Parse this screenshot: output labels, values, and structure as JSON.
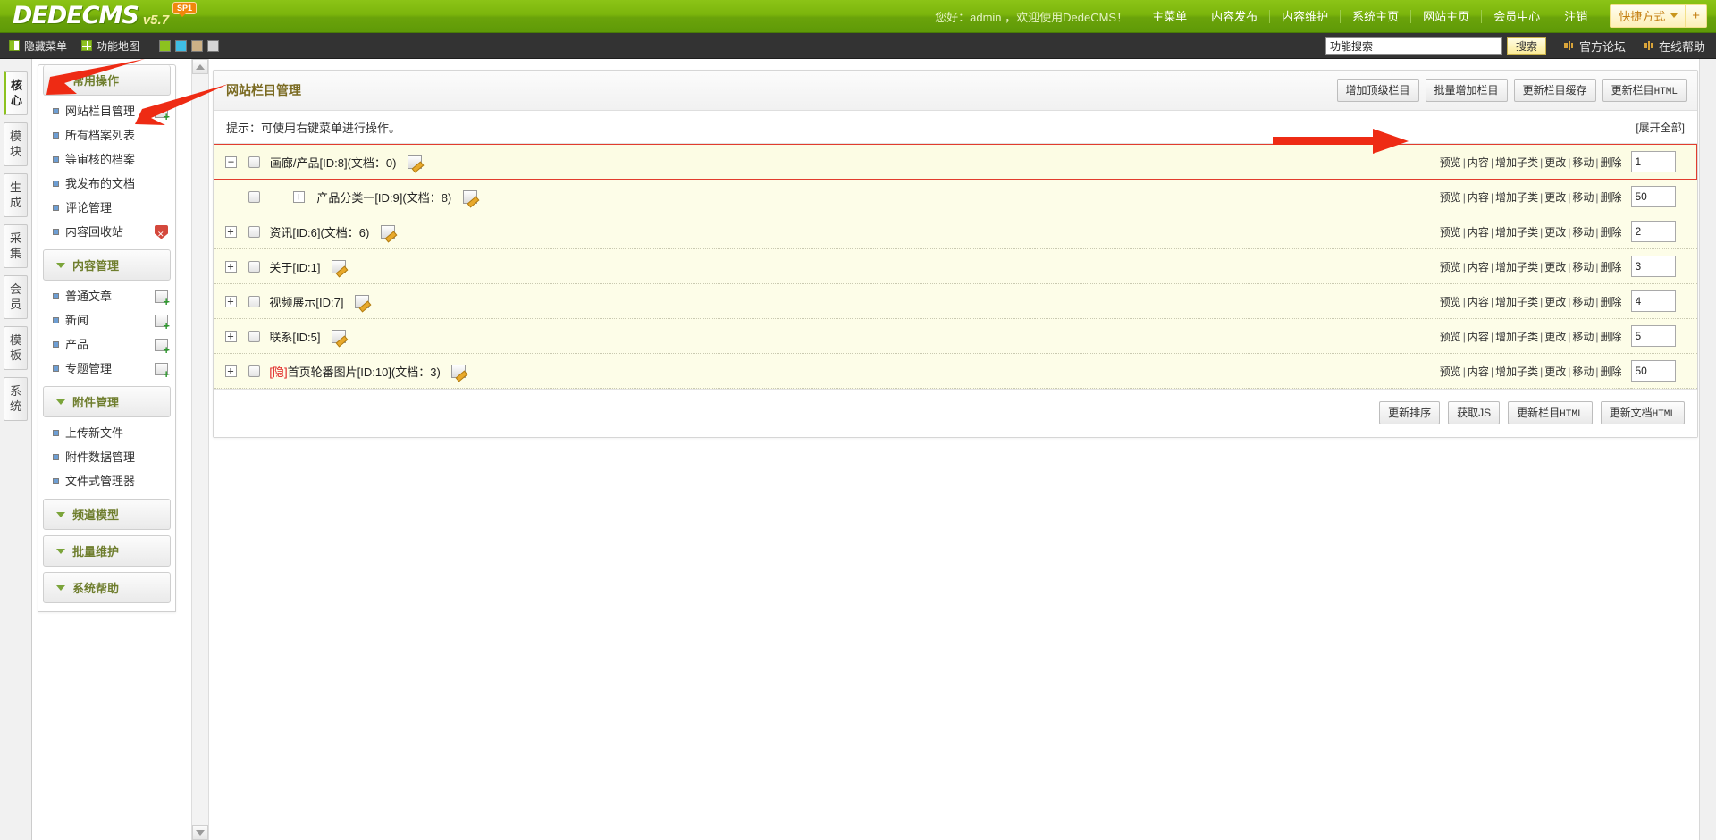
{
  "brand": {
    "name": "DEDECMS",
    "version": "v5.7",
    "badge": "SP1"
  },
  "topnav": {
    "welcome": "您好：admin ，欢迎使用DedeCMS！",
    "links": [
      "主菜单",
      "内容发布",
      "内容维护",
      "系统主页",
      "网站主页",
      "会员中心",
      "注销"
    ],
    "shortcut_label": "快捷方式",
    "shortcut_plus": "+"
  },
  "subbar": {
    "hide_menu": "隐藏菜单",
    "func_map": "功能地图",
    "swatches": [
      "#8cc21f",
      "#3fbde4",
      "#cdb186",
      "#d5d5d5"
    ],
    "search": {
      "value": "功能搜索",
      "placeholder": "功能搜索",
      "button": "搜索"
    },
    "forum": "官方论坛",
    "help": "在线帮助"
  },
  "rail": {
    "tabs": [
      {
        "label": "核心",
        "chars": [
          "核",
          "心"
        ],
        "active": true
      },
      {
        "label": "模块",
        "chars": [
          "模",
          "块"
        ],
        "active": false
      },
      {
        "label": "生成",
        "chars": [
          "生",
          "成"
        ],
        "active": false
      },
      {
        "label": "采集",
        "chars": [
          "采",
          "集"
        ],
        "active": false
      },
      {
        "label": "会员",
        "chars": [
          "会",
          "员"
        ],
        "active": false
      },
      {
        "label": "模板",
        "chars": [
          "模",
          "板"
        ],
        "active": false
      },
      {
        "label": "系统",
        "chars": [
          "系",
          "统"
        ],
        "active": false
      }
    ]
  },
  "sidebar": {
    "groups": [
      {
        "title": "常用操作",
        "items": [
          {
            "label": "网站栏目管理",
            "icon": "add-doc-icon"
          },
          {
            "label": "所有档案列表",
            "icon": ""
          },
          {
            "label": "等审核的档案",
            "icon": ""
          },
          {
            "label": "我发布的文档",
            "icon": ""
          },
          {
            "label": "评论管理",
            "icon": ""
          },
          {
            "label": "内容回收站",
            "icon": "recycle-icon"
          }
        ]
      },
      {
        "title": "内容管理",
        "items": [
          {
            "label": "普通文章",
            "icon": "add-doc-icon"
          },
          {
            "label": "新闻",
            "icon": "add-doc-icon"
          },
          {
            "label": "产品",
            "icon": "add-doc-icon"
          },
          {
            "label": "专题管理",
            "icon": "add-doc-icon"
          }
        ]
      },
      {
        "title": "附件管理",
        "items": [
          {
            "label": "上传新文件",
            "icon": ""
          },
          {
            "label": "附件数据管理",
            "icon": ""
          },
          {
            "label": "文件式管理器",
            "icon": ""
          }
        ]
      },
      {
        "title": "频道模型",
        "items": []
      },
      {
        "title": "批量维护",
        "items": []
      },
      {
        "title": "系统帮助",
        "items": []
      }
    ]
  },
  "main": {
    "title": "网站栏目管理",
    "head_buttons": [
      {
        "label": "增加顶级栏目",
        "mono_tail": ""
      },
      {
        "label": "批量增加栏目",
        "mono_tail": ""
      },
      {
        "label": "更新栏目缓存",
        "mono_tail": ""
      },
      {
        "label": "更新栏目",
        "mono_tail": "HTML"
      }
    ],
    "tip": "提示：可使用右键菜单进行操作。",
    "expand_all": "[展开全部]",
    "ops": {
      "preview": "预览",
      "content": "内容",
      "add_child": "增加子类",
      "edit": "更改",
      "move": "移动",
      "delete": "删除"
    },
    "rows": [
      {
        "toggle": "−",
        "indent": false,
        "name": "画廊/产品[ID:8](文档：0)",
        "hidden_tag": "",
        "rank": "1",
        "selected": true,
        "has_toggle": true
      },
      {
        "toggle": "+",
        "indent": true,
        "name": "产品分类一[ID:9](文档：8)",
        "hidden_tag": "",
        "rank": "50",
        "selected": false,
        "has_toggle": false
      },
      {
        "toggle": "+",
        "indent": false,
        "name": "资讯[ID:6](文档：6)",
        "hidden_tag": "",
        "rank": "2",
        "selected": false,
        "has_toggle": true
      },
      {
        "toggle": "+",
        "indent": false,
        "name": "关于[ID:1]",
        "hidden_tag": "",
        "rank": "3",
        "selected": false,
        "has_toggle": true
      },
      {
        "toggle": "+",
        "indent": false,
        "name": "视频展示[ID:7]",
        "hidden_tag": "",
        "rank": "4",
        "selected": false,
        "has_toggle": true
      },
      {
        "toggle": "+",
        "indent": false,
        "name": "联系[ID:5]",
        "hidden_tag": "",
        "rank": "5",
        "selected": false,
        "has_toggle": true
      },
      {
        "toggle": "+",
        "indent": false,
        "name": "首页轮番图片[ID:10](文档：3)",
        "hidden_tag": "[隐]",
        "rank": "50",
        "selected": false,
        "has_toggle": true
      }
    ],
    "foot_buttons": [
      {
        "label": "更新排序",
        "mono_tail": ""
      },
      {
        "label": "获取JS",
        "mono_tail": ""
      },
      {
        "label": "更新栏目",
        "mono_tail": "HTML"
      },
      {
        "label": "更新文档",
        "mono_tail": "HTML"
      }
    ]
  },
  "colors": {
    "brand_green": "#8cc417",
    "header_dark": "#333333",
    "row_bg": "#fdfde8",
    "selection_border": "#e23c2e",
    "title_brown": "#7a6a21",
    "group_green": "#6f7e2e"
  }
}
